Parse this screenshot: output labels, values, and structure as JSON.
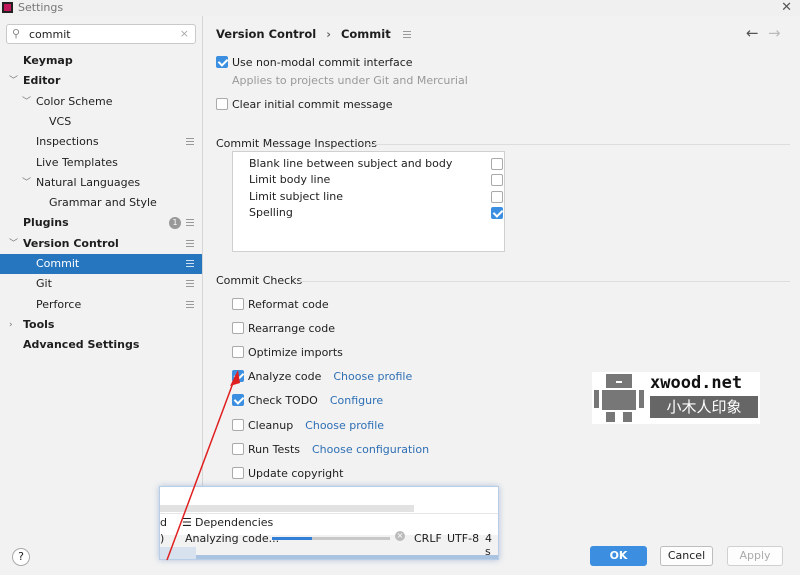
{
  "window": {
    "title": "Settings"
  },
  "search": {
    "value": "commit",
    "icon": "search-icon"
  },
  "sidebar": {
    "items": [
      {
        "label": "Keymap"
      },
      {
        "label": "Editor"
      },
      {
        "label": "Color Scheme"
      },
      {
        "label": "VCS"
      },
      {
        "label": "Inspections"
      },
      {
        "label": "Live Templates"
      },
      {
        "label": "Natural Languages"
      },
      {
        "label": "Grammar and Style"
      },
      {
        "label": "Plugins",
        "badge": "1"
      },
      {
        "label": "Version Control"
      },
      {
        "label": "Commit"
      },
      {
        "label": "Git"
      },
      {
        "label": "Perforce"
      },
      {
        "label": "Tools"
      },
      {
        "label": "Advanced Settings"
      }
    ]
  },
  "breadcrumb": {
    "parent": "Version Control",
    "sep": "›",
    "current": "Commit"
  },
  "options": {
    "non_modal": {
      "label": "Use non-modal commit interface",
      "checked": true,
      "hint": "Applies to projects under Git and Mercurial"
    },
    "clear_initial": {
      "label": "Clear initial commit message",
      "checked": false
    }
  },
  "inspections": {
    "title": "Commit Message Inspections",
    "items": [
      {
        "label": "Blank line between subject and body",
        "checked": false
      },
      {
        "label": "Limit body line",
        "checked": false
      },
      {
        "label": "Limit subject line",
        "checked": false
      },
      {
        "label": "Spelling",
        "checked": true
      }
    ]
  },
  "checks": {
    "title": "Commit Checks",
    "items": [
      {
        "label": "Reformat code",
        "checked": false,
        "link": ""
      },
      {
        "label": "Rearrange code",
        "checked": false,
        "link": ""
      },
      {
        "label": "Optimize imports",
        "checked": false,
        "link": ""
      },
      {
        "label": "Analyze code",
        "checked": true,
        "link": "Choose profile"
      },
      {
        "label": "Check TODO",
        "checked": true,
        "link": "Configure"
      },
      {
        "label": "Cleanup",
        "checked": false,
        "link": "Choose profile"
      },
      {
        "label": "Run Tests",
        "checked": false,
        "link": "Choose configuration"
      },
      {
        "label": "Update copyright",
        "checked": false,
        "link": ""
      }
    ]
  },
  "popup": {
    "left_frag": "d",
    "tab": "Dependencies",
    "left_frag2": ")",
    "status": "Analyzing code...",
    "progress_pct": 34,
    "line_sep": "CRLF",
    "encoding": "UTF-8",
    "extra": "4 s"
  },
  "watermark": {
    "text": "xwood.net",
    "sub": "小木人印象"
  },
  "footer": {
    "help": "?",
    "ok": "OK",
    "cancel": "Cancel",
    "apply": "Apply"
  },
  "colors": {
    "accent": "#2675bf",
    "ok_button": "#3c8fe0",
    "link": "#2e6fb4",
    "arrow": "#e02020"
  }
}
